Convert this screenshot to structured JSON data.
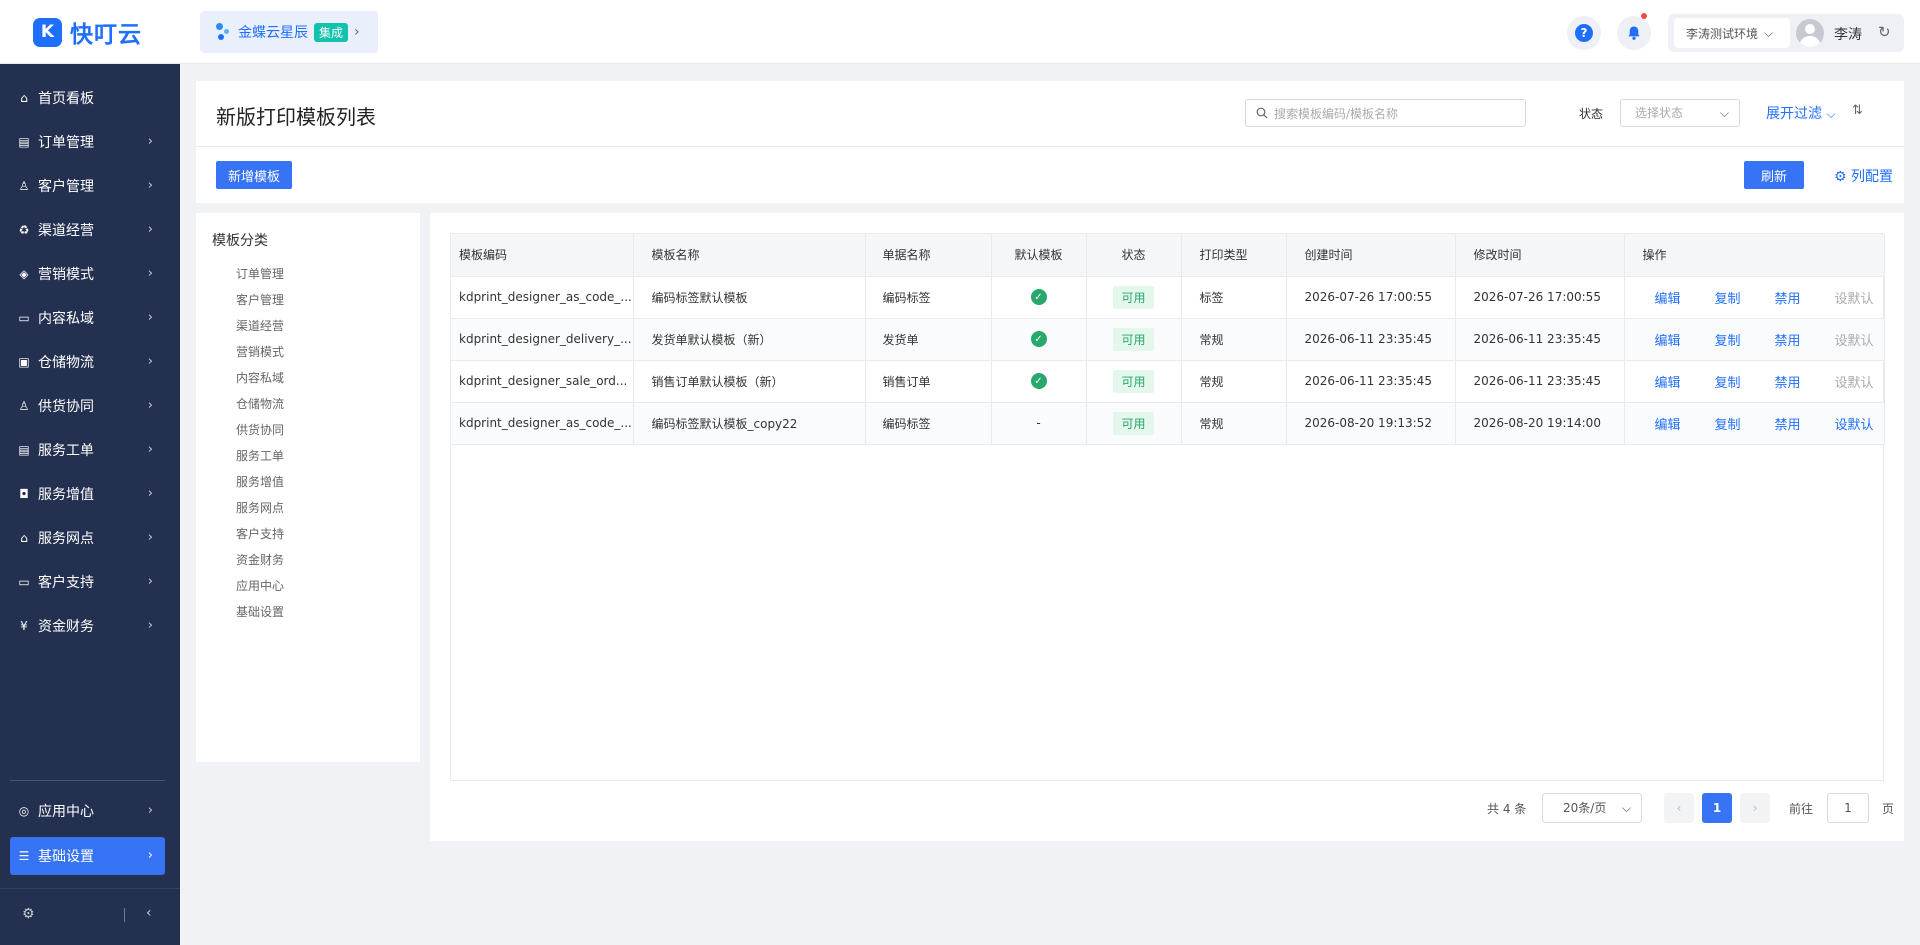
{
  "app": {
    "logo_glyph": "K",
    "name": "快叮云",
    "brand_color": "#1f6fff"
  },
  "integration": {
    "name": "金蝶云星辰",
    "badge": "集成",
    "badge_color": "#12c2ad"
  },
  "topbar": {
    "help_icon": "question-icon",
    "help_glyph": "?",
    "bell_icon": "bell-icon",
    "environment": "李涛测试环境",
    "username": "李涛"
  },
  "sidebar": {
    "items": [
      {
        "label": "首页看板",
        "icon": "home-icon",
        "glyph": "⌂",
        "has_chevron": false
      },
      {
        "label": "订单管理",
        "icon": "order-icon",
        "glyph": "▤",
        "has_chevron": true
      },
      {
        "label": "客户管理",
        "icon": "user-icon",
        "glyph": "♙",
        "has_chevron": true
      },
      {
        "label": "渠道经营",
        "icon": "channel-icon",
        "glyph": "♻",
        "has_chevron": true
      },
      {
        "label": "营销模式",
        "icon": "tag-icon",
        "glyph": "◈",
        "has_chevron": true
      },
      {
        "label": "内容私域",
        "icon": "image-icon",
        "glyph": "▭",
        "has_chevron": true
      },
      {
        "label": "仓储物流",
        "icon": "warehouse-icon",
        "glyph": "▣",
        "has_chevron": true
      },
      {
        "label": "供货协同",
        "icon": "supply-icon",
        "glyph": "♙",
        "has_chevron": true
      },
      {
        "label": "服务工单",
        "icon": "ticket-icon",
        "glyph": "▤",
        "has_chevron": true
      },
      {
        "label": "服务增值",
        "icon": "bag-icon",
        "glyph": "◘",
        "has_chevron": true
      },
      {
        "label": "服务网点",
        "icon": "store-icon",
        "glyph": "⌂",
        "has_chevron": true
      },
      {
        "label": "客户支持",
        "icon": "support-icon",
        "glyph": "▭",
        "has_chevron": true
      },
      {
        "label": "资金财务",
        "icon": "yen-icon",
        "glyph": "¥",
        "has_chevron": true
      }
    ],
    "bottom_items": [
      {
        "label": "应用中心",
        "icon": "cube-icon",
        "glyph": "◎",
        "active": false
      },
      {
        "label": "基础设置",
        "icon": "settings-icon",
        "glyph": "☰",
        "active": true
      }
    ],
    "active_color": "#3673f5",
    "bg_color": "#233050"
  },
  "header": {
    "title": "新版打印模板列表",
    "search_placeholder": "搜索模板编码/模板名称",
    "status_label": "状态",
    "status_placeholder": "选择状态",
    "expand_filter": "展开过滤",
    "add_button": "新增模板",
    "refresh_button": "刷新",
    "column_config": "列配置"
  },
  "categories": {
    "title": "模板分类",
    "items": [
      "订单管理",
      "客户管理",
      "渠道经营",
      "营销模式",
      "内容私域",
      "仓储物流",
      "供货协同",
      "服务工单",
      "服务增值",
      "服务网点",
      "客户支持",
      "资金财务",
      "应用中心",
      "基础设置"
    ]
  },
  "table": {
    "columns": [
      "模板编码",
      "模板名称",
      "单据名称",
      "默认模板",
      "状态",
      "打印类型",
      "创建时间",
      "修改时间",
      "操作"
    ],
    "rows": [
      {
        "code": "kdprint_designer_as_code_...",
        "name": "编码标签默认模板",
        "doc": "编码标签",
        "is_default": true,
        "default_text": "",
        "status": "可用",
        "print_type": "标签",
        "created": "2026-07-26 17:00:55",
        "modified": "2026-07-26 17:00:55",
        "set_default_enabled": false
      },
      {
        "code": "kdprint_designer_delivery_...",
        "name": "发货单默认模板（新）",
        "doc": "发货单",
        "is_default": true,
        "default_text": "",
        "status": "可用",
        "print_type": "常规",
        "created": "2026-06-11 23:35:45",
        "modified": "2026-06-11 23:35:45",
        "set_default_enabled": false
      },
      {
        "code": "kdprint_designer_sale_ord...",
        "name": "销售订单默认模板（新）",
        "doc": "销售订单",
        "is_default": true,
        "default_text": "",
        "status": "可用",
        "print_type": "常规",
        "created": "2026-06-11 23:35:45",
        "modified": "2026-06-11 23:35:45",
        "set_default_enabled": false
      },
      {
        "code": "kdprint_designer_as_code_...",
        "name": "编码标签默认模板_copy22",
        "doc": "编码标签",
        "is_default": false,
        "default_text": "-",
        "status": "可用",
        "print_type": "常规",
        "created": "2026-08-20 19:13:52",
        "modified": "2026-08-20 19:14:00",
        "set_default_enabled": true
      }
    ],
    "actions": {
      "edit": "编辑",
      "copy": "复制",
      "disable": "禁用",
      "set_default": "设默认"
    }
  },
  "pagination": {
    "total": "共 4 条",
    "page_size": "20条/页",
    "current_page": "1",
    "goto_label": "前往",
    "goto_value": "1",
    "page_suffix": "页"
  }
}
